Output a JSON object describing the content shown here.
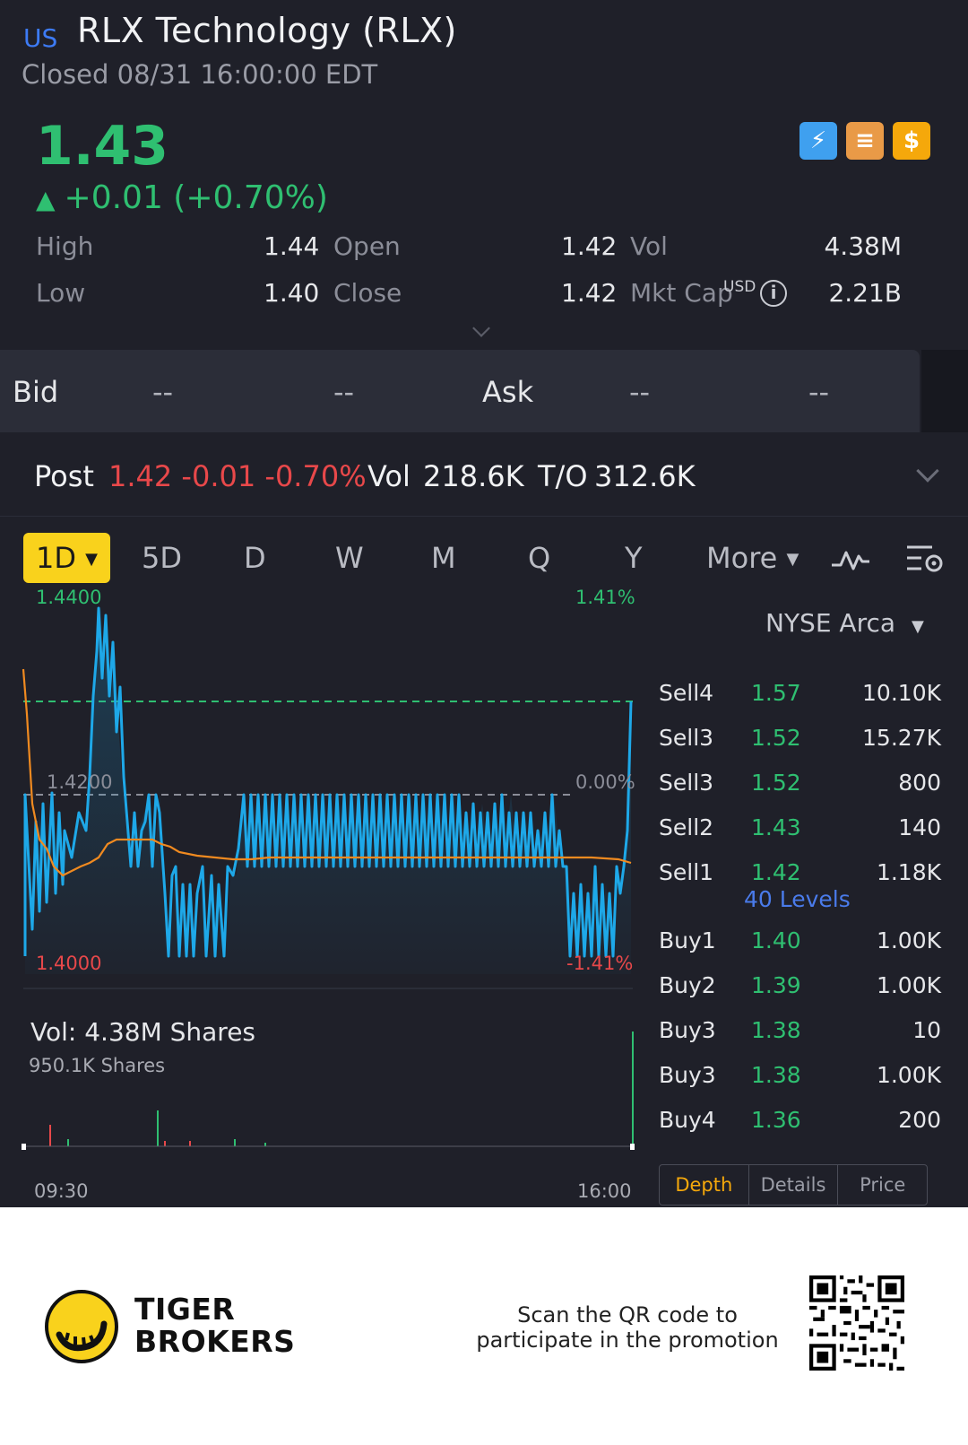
{
  "header": {
    "market_tag": "US",
    "title": "RLX Technology (RLX)",
    "status": "Closed 08/31 16:00:00 EDT",
    "price": "1.43",
    "change": "+0.01 (+0.70%)",
    "colors": {
      "up": "#2fbf71",
      "down": "#e8484a",
      "accent": "#f9d21c"
    }
  },
  "stats": {
    "high_label": "High",
    "high": "1.44",
    "low_label": "Low",
    "low": "1.40",
    "open_label": "Open",
    "open": "1.42",
    "close_label": "Close",
    "close": "1.42",
    "vol_label": "Vol",
    "vol": "4.38M",
    "mktcap_label": "Mkt Cap",
    "mktcap_unit": "USD",
    "mktcap": "2.21B"
  },
  "bidask": {
    "bid_label": "Bid",
    "bid_price": "--",
    "bid_size": "--",
    "ask_label": "Ask",
    "ask_price": "--",
    "ask_size": "--"
  },
  "post": {
    "label": "Post",
    "price_change": "1.42 -0.01 -0.70%",
    "vol_label": "Vol",
    "vol": "218.6K",
    "to_label": "T/O",
    "to": "312.6K"
  },
  "tabs": {
    "active": "1D",
    "items": [
      "5D",
      "D",
      "W",
      "M",
      "Q",
      "Y"
    ],
    "more": "More"
  },
  "chart": {
    "high_price": "1.4400",
    "mid_price": "1.4200",
    "low_price": "1.4000",
    "high_pct": "1.41%",
    "mid_pct": "0.00%",
    "low_pct": "-1.41%",
    "vol_title": "Vol:  4.38M Shares",
    "vol_max": "950.1K Shares",
    "time_start": "09:30",
    "time_end": "16:00"
  },
  "chart_data": {
    "type": "line",
    "ylim": [
      1.4,
      1.44
    ],
    "x": [
      "09:30",
      "16:00"
    ],
    "series": []
  },
  "book": {
    "exchange": "NYSE Arca",
    "sells": [
      {
        "side": "Sell4",
        "price": "1.57",
        "qty": "10.10K"
      },
      {
        "side": "Sell3",
        "price": "1.52",
        "qty": "15.27K"
      },
      {
        "side": "Sell3",
        "price": "1.52",
        "qty": "800"
      },
      {
        "side": "Sell2",
        "price": "1.43",
        "qty": "140"
      },
      {
        "side": "Sell1",
        "price": "1.42",
        "qty": "1.18K"
      }
    ],
    "levels": "40 Levels",
    "buys": [
      {
        "side": "Buy1",
        "price": "1.40",
        "qty": "1.00K"
      },
      {
        "side": "Buy2",
        "price": "1.39",
        "qty": "1.00K"
      },
      {
        "side": "Buy3",
        "price": "1.38",
        "qty": "10"
      },
      {
        "side": "Buy3",
        "price": "1.38",
        "qty": "1.00K"
      },
      {
        "side": "Buy4",
        "price": "1.36",
        "qty": "200"
      }
    ],
    "tabs": [
      "Depth",
      "Details",
      "Price"
    ]
  },
  "footer": {
    "brand_line1": "TIGER",
    "brand_line2": "BROKERS",
    "promo": "Scan the QR code to participate in the promotion"
  }
}
